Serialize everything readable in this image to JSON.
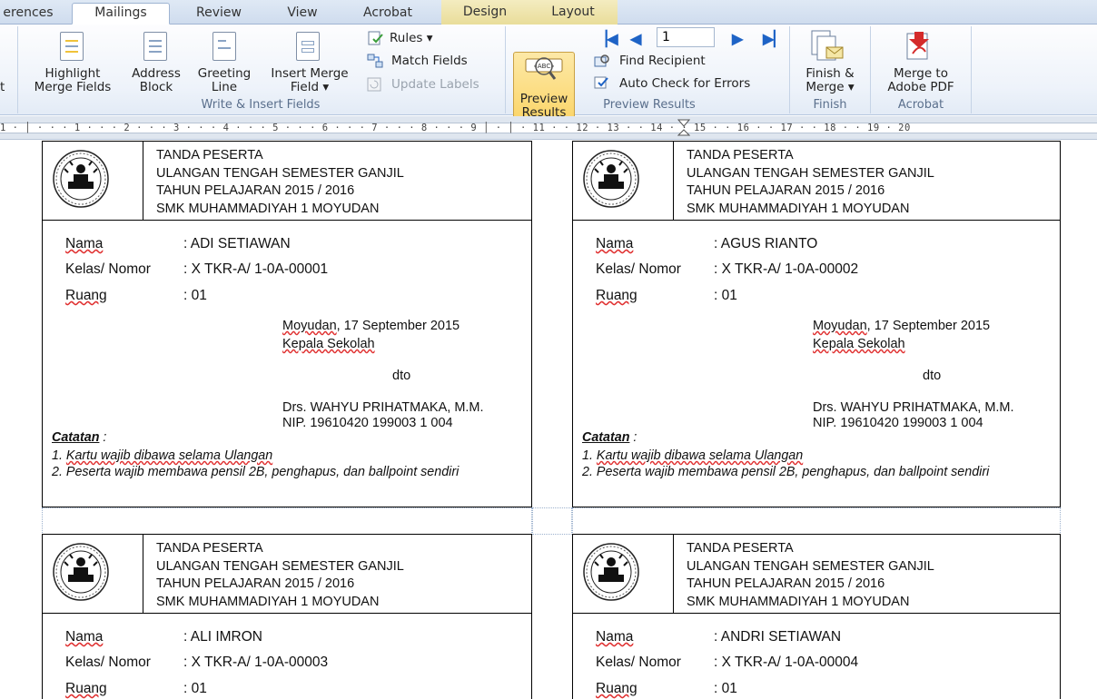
{
  "tabs": {
    "references": "erences",
    "mailings": "Mailings",
    "review": "Review",
    "view": "View",
    "acrobat": "Acrobat",
    "design": "Design",
    "layout": "Layout"
  },
  "ribbon": {
    "left_cut": "t",
    "highlight_1": "Highlight",
    "highlight_2": "Merge Fields",
    "address_1": "Address",
    "address_2": "Block",
    "greeting_1": "Greeting",
    "greeting_2": "Line",
    "insert_1": "Insert Merge",
    "insert_2": "Field ▾",
    "rules": "Rules ▾",
    "match_fields": "Match Fields",
    "update_labels": "Update Labels",
    "group_write": "Write & Insert Fields",
    "preview_1": "Preview",
    "preview_2": "Results",
    "record_value": "1",
    "find_recipient": "Find Recipient",
    "auto_check": "Auto Check for Errors",
    "group_preview": "Preview Results",
    "finish_1": "Finish &",
    "finish_2": "Merge ▾",
    "group_finish": "Finish",
    "merge_adobe_1": "Merge to",
    "merge_adobe_2": "Adobe PDF",
    "group_acrobat": "Acrobat"
  },
  "ruler": {
    "text": "1 · │ · · · 1 · · · 2 · · · 3 · · · 4 · · · 5 · · · 6 · · · 7 · · · 8 · · · 9 │ · │ · 11 · · 12 · 13 · · 14 · · 15 · · 16 · · 17 · · 18 · · 19 · 20"
  },
  "header": {
    "line1": "TANDA PESERTA",
    "line2": "ULANGAN  TENGAH SEMESTER GANJIL",
    "line3": "TAHUN PELAJARAN 2015 / 2016",
    "line4": "SMK MUHAMMADIYAH 1 MOYUDAN"
  },
  "labels": {
    "nama": "Nama",
    "kelas": "Kelas/ Nomor",
    "ruang": "Ruang"
  },
  "signature": {
    "place": "Moyudan",
    "date": ", 17 September  2015",
    "role": "Kepala Sekolah",
    "dto": "dto",
    "name": "Drs. WAHYU PRIHATMAKA, M.M.",
    "nip": " NIP. 19610420 199003 1 004"
  },
  "notes": {
    "title": "Catatan",
    "colon": " :",
    "n1_prefix": "1. ",
    "n1": "Kartu wajib dibawa selama Ulangan",
    "n2_prefix": "2. ",
    "n2": "Peserta wajib membawa pensil 2B, penghapus, dan ballpoint sendiri"
  },
  "cards": [
    {
      "nama": ": ADI SETIAWAN",
      "kelas": ": X TKR-A/ 1-0A-00001",
      "ruang": ": 01"
    },
    {
      "nama": ": AGUS RIANTO",
      "kelas": ": X TKR-A/ 1-0A-00002",
      "ruang": ": 01"
    },
    {
      "nama": ": ALI IMRON",
      "kelas": ": X TKR-A/ 1-0A-00003",
      "ruang": ": 01"
    },
    {
      "nama": ": ANDRI SETIAWAN",
      "kelas": ": X TKR-A/ 1-0A-00004",
      "ruang": ": 01"
    }
  ],
  "colors": {
    "ribbon_blue": "#1e63c6",
    "highlight_yellow": "#fbd56a",
    "spelling_red": "#e03030"
  }
}
